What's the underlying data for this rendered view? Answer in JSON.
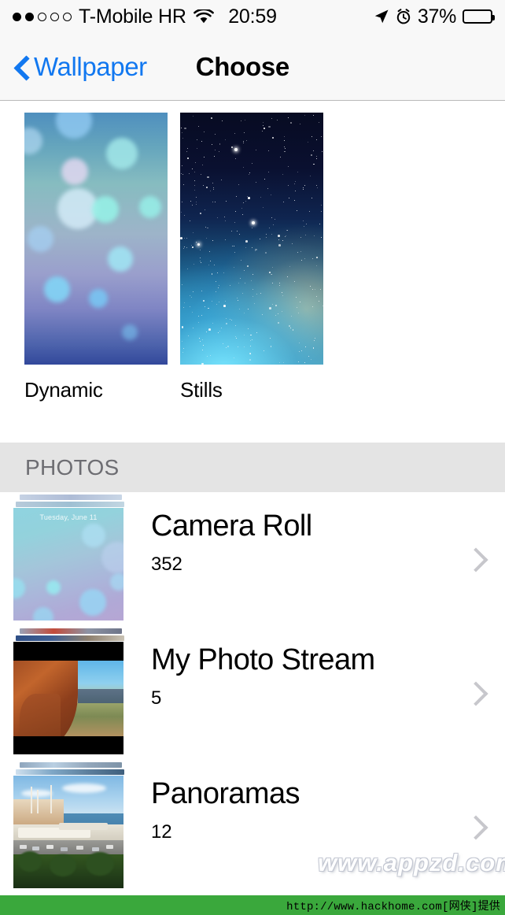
{
  "status_bar": {
    "signal_dots_filled": 2,
    "signal_dots_total": 5,
    "carrier": "T-Mobile HR",
    "wifi_icon": "wifi-icon",
    "time": "20:59",
    "location_icon": "location-arrow-icon",
    "alarm_icon": "alarm-clock-icon",
    "battery_percent": "37%",
    "battery_level": 37,
    "battery_icon": "battery-icon"
  },
  "nav_bar": {
    "back_icon": "chevron-left-icon",
    "back_label": "Wallpaper",
    "title": "Choose",
    "accent_color": "#1278f0"
  },
  "wallpaper_types": [
    {
      "label": "Dynamic",
      "thumb": "dynamic-bokeh-wallpaper"
    },
    {
      "label": "Stills",
      "thumb": "stills-nebula-wallpaper"
    }
  ],
  "photos_section": {
    "header": "PHOTOS",
    "header_bg": "#e4e4e4",
    "albums": [
      {
        "title": "Camera Roll",
        "count": "352",
        "thumb": "lockscreen-bokeh-thumbnail",
        "thumb_overlay_text": "Tuesday, June 11",
        "chevron_icon": "chevron-right-icon"
      },
      {
        "title": "My Photo Stream",
        "count": "5",
        "thumb": "desert-arch-thumbnail",
        "chevron_icon": "chevron-right-icon"
      },
      {
        "title": "Panoramas",
        "count": "12",
        "thumb": "harbor-panorama-thumbnail",
        "chevron_icon": "chevron-right-icon"
      }
    ]
  },
  "watermarks": {
    "appzd": "www.appzd.com",
    "footer_bar_text": "http://www.hackhome.com[网侠]提供",
    "footer_bar_color": "#3aa83c"
  }
}
